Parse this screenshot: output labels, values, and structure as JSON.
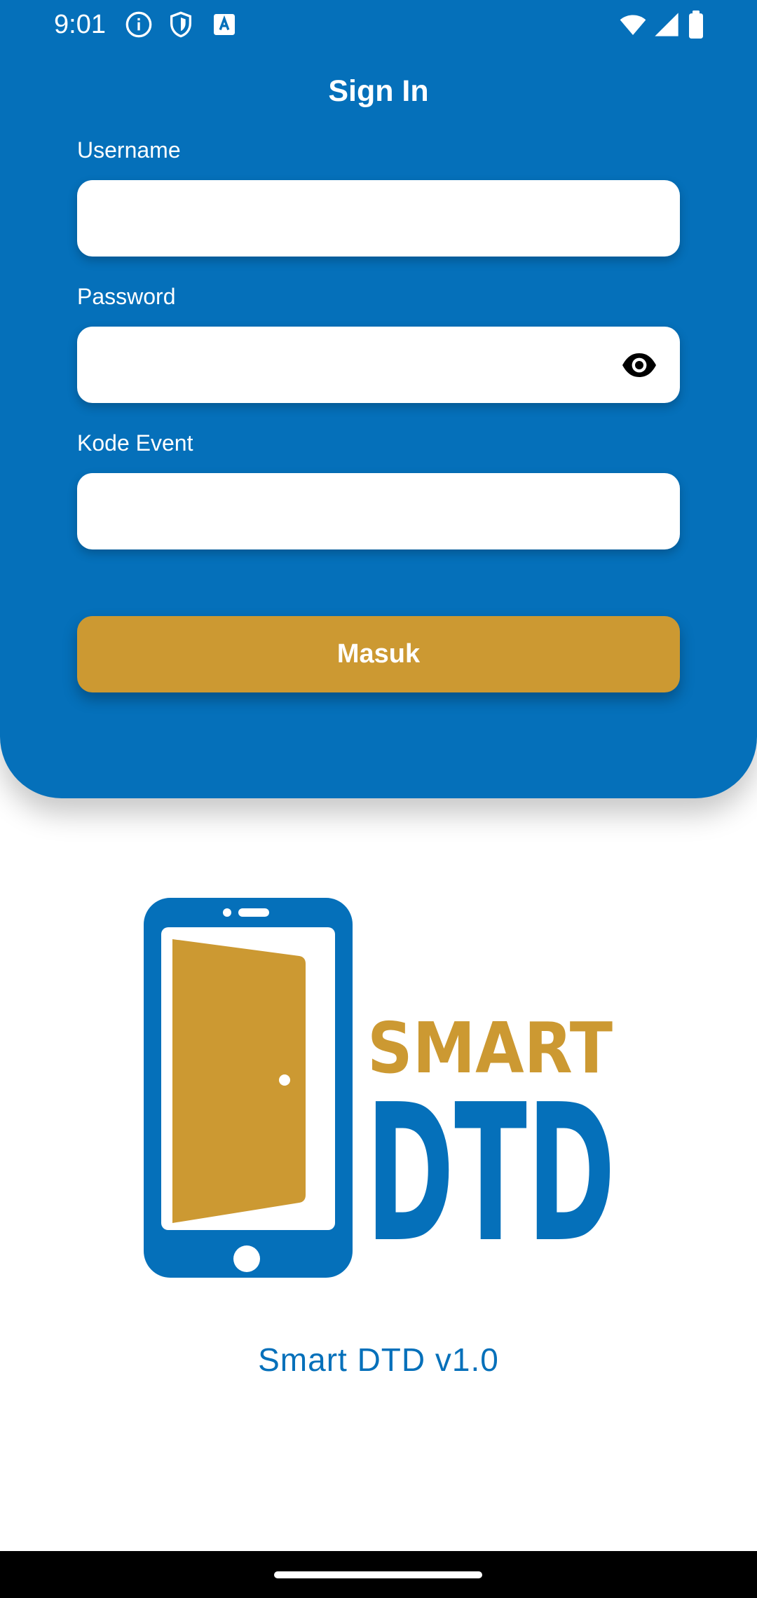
{
  "colors": {
    "primary_blue": "#0570ba",
    "accent_gold": "#cc9932",
    "text_white": "#ffffff"
  },
  "status_bar": {
    "time": "9:01",
    "left_icons": [
      "info-icon",
      "shield-icon",
      "text-box-icon"
    ],
    "right_icons": [
      "wifi-icon",
      "signal-icon",
      "battery-icon"
    ]
  },
  "login": {
    "title": "Sign In",
    "username": {
      "label": "Username",
      "value": "",
      "placeholder": ""
    },
    "password": {
      "label": "Password",
      "value": "",
      "placeholder": ""
    },
    "event_code": {
      "label": "Kode Event",
      "value": "",
      "placeholder": ""
    },
    "submit_label": "Masuk"
  },
  "logo": {
    "word_top": "SMART",
    "word_bottom": "DTD"
  },
  "footer": {
    "version": "Smart DTD v1.0"
  }
}
